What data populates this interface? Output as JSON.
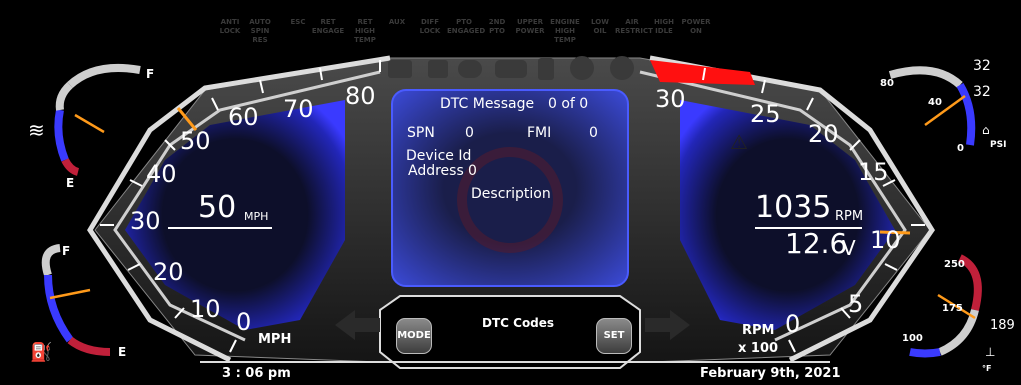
{
  "telltales": [
    {
      "label": "ANTI\nLOCK"
    },
    {
      "label": "AUTO\nSPIN\nRES"
    },
    {
      "label": "ESC"
    },
    {
      "label": "RET\nENGAGE"
    },
    {
      "label": "RET\nHIGH\nTEMP"
    },
    {
      "label": "AUX"
    },
    {
      "label": "DIFF\nLOCK"
    },
    {
      "label": "PTO\nENGAGED"
    },
    {
      "label": "2ND\nPTO"
    },
    {
      "label": "UPPER\nPOWER"
    },
    {
      "label": "ENGINE\nHIGH\nTEMP"
    },
    {
      "label": "LOW\nOIL"
    },
    {
      "label": "AIR\nRESTRICT"
    },
    {
      "label": "HIGH\nIDLE"
    },
    {
      "label": "POWER\nON"
    }
  ],
  "speedometer": {
    "ticks": [
      "0",
      "10",
      "20",
      "30",
      "40",
      "50",
      "60",
      "70",
      "80"
    ],
    "value": "50",
    "unit_small": "MPH",
    "unit_label": "MPH",
    "needle_value": 50
  },
  "tachometer": {
    "ticks": [
      "0",
      "5",
      "10",
      "15",
      "20",
      "25",
      "30"
    ],
    "rpm_value": "1035",
    "rpm_unit": "RPM",
    "voltage_value": "12.6",
    "voltage_unit": "V",
    "unit_label_1": "RPM",
    "unit_label_2": "x 100",
    "redline_from": 27
  },
  "dtc_panel": {
    "title": "DTC Message",
    "counter": "0 of 0",
    "spn_label": "SPN",
    "spn_value": "0",
    "fmi_label": "FMI",
    "fmi_value": "0",
    "device_id_label": "Device Id",
    "address_label": "Address",
    "address_value": "0",
    "description_label": "Description"
  },
  "bottom_bar": {
    "mode_label": "MODE",
    "set_label": "SET",
    "screen_title": "DTC Codes"
  },
  "coolant_gauge": {
    "full_label": "F",
    "empty_label": "E",
    "level_fraction": 0.45
  },
  "fuel_gauge": {
    "full_label": "F",
    "empty_label": "E",
    "level_fraction": 0.5
  },
  "oil_pressure_gauge": {
    "tick_80": "80",
    "tick_40": "40",
    "tick_0": "0",
    "unit": "PSI",
    "readout_top": "32",
    "readout_2": "32",
    "level_fraction": 0.4
  },
  "temp_gauge": {
    "tick_250": "250",
    "tick_175": "175",
    "tick_100": "100",
    "unit": "°F",
    "readout": "189",
    "level_fraction": 0.6
  },
  "time": "3 : 06 pm",
  "date": "February 9th, 2021",
  "colors": {
    "accent_blue": "#2b2bd8",
    "redline": "#ff0000",
    "needle": "#ff9a1a",
    "panel": "#1e2a7a"
  }
}
